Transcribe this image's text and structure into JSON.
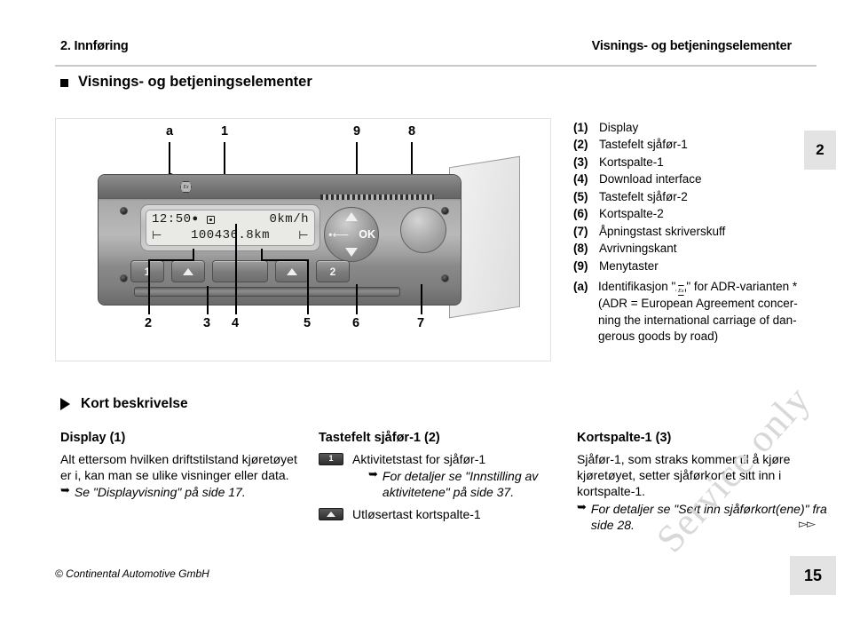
{
  "runhead": {
    "left": "2. Innføring",
    "right": "Visnings- og betjeningselementer"
  },
  "section": {
    "title": "Visnings- og betjeningselementer"
  },
  "chapter_tab": "2",
  "figure": {
    "callouts_top": [
      "a",
      "1",
      "9",
      "8"
    ],
    "callouts_bottom": [
      "2",
      "3",
      "4",
      "5",
      "6",
      "7"
    ],
    "device": {
      "ex_badge": "Ex",
      "lcd": {
        "time": "12:50",
        "speed": "0km/h",
        "odometer": "100436.8km",
        "bed_left": "⊢",
        "bed_right": "⊢"
      },
      "keys": {
        "driver1": "1",
        "eject1": "eject-icon",
        "eject2": "eject-icon",
        "driver2": "2"
      },
      "nav": {
        "ok": "OK",
        "up": "up-arrow-icon",
        "down": "down-arrow-icon",
        "back": "back-arrow-icon"
      }
    }
  },
  "legend": {
    "items": [
      {
        "num": "(1)",
        "label": "Display"
      },
      {
        "num": "(2)",
        "label": "Tastefelt sjåfør-1"
      },
      {
        "num": "(3)",
        "label": "Kortspalte-1"
      },
      {
        "num": "(4)",
        "label": "Download interface"
      },
      {
        "num": "(5)",
        "label": "Tastefelt sjåfør-2"
      },
      {
        "num": "(6)",
        "label": "Kortspalte-2"
      },
      {
        "num": "(7)",
        "label": "Åpningstast skriverskuff"
      },
      {
        "num": "(8)",
        "label": "Avrivningskant"
      },
      {
        "num": "(9)",
        "label": "Menytaster"
      }
    ]
  },
  "footnote": {
    "num": "(a)",
    "line1_before": "Identifikasjon \"",
    "line1_after": "\" for ADR-varianten *",
    "line2": "(ADR = European Agreement concer-",
    "line3": "ning the international carriage of dan-",
    "line4": "gerous goods by road)"
  },
  "short_description": {
    "heading": "Kort beskrivelse"
  },
  "columns": {
    "display": {
      "heading": "Display (1)",
      "body": "Alt ettersom hvilken driftstilstand kjøretøyet er i, kan man se ulike visninger eller data.",
      "ref": "Se \"Displayvisning\" på side 17."
    },
    "keypad": {
      "heading": "Tastefelt sjåfør-1 (2)",
      "item1_icon": "1",
      "item1_text": "Aktivitetstast for sjåfør-1",
      "item1_ref": "For detaljer se \"Innstilling av aktivitetene\" på side 37.",
      "item2_icon": "eject-icon",
      "item2_text": "Utløsertast kortspalte-1"
    },
    "cardslot": {
      "heading": "Kortspalte-1 (3)",
      "body": "Sjåfør-1, som straks kommer til å kjøre kjøretøyet, setter sjåførkortet sitt inn i kortspalte-1.",
      "ref": "For detaljer se \"Sett inn sjåførkort(ene)\" fra side 28."
    }
  },
  "watermark": "Service only",
  "continuation_marker": "▻▻",
  "footer": {
    "copyright": "© Continental Automotive GmbH",
    "page": "15"
  }
}
